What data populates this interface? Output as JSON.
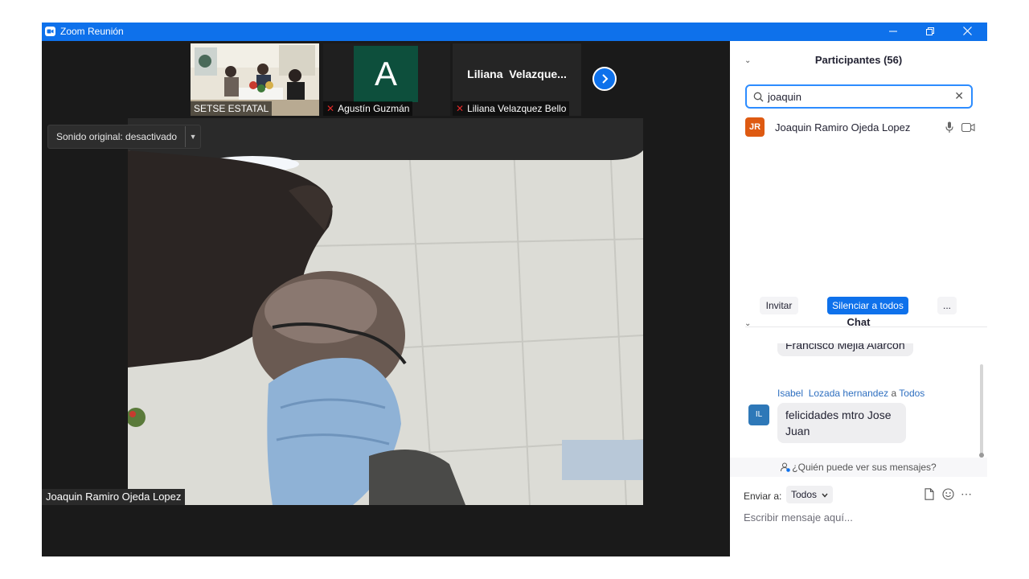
{
  "window": {
    "title": "Zoom Reunión",
    "controls": [
      "minimize",
      "restore",
      "close"
    ]
  },
  "thumbnails": [
    {
      "name": "SETSE ESTATAL",
      "muted": false,
      "type": "video"
    },
    {
      "name": "Agustín Guzmán",
      "muted": true,
      "type": "avatar",
      "initial": "A",
      "color": "#0d4f3c"
    },
    {
      "name": "Liliana Velazquez Bello",
      "muted": true,
      "type": "name-only",
      "display": "Liliana  Velazque..."
    }
  ],
  "stage": {
    "sound_label": "Sonido original: desactivado",
    "speaker_name": "Joaquin Ramiro Ojeda Lopez"
  },
  "participants": {
    "header": "Participantes (56)",
    "search_value": "joaquin",
    "list": [
      {
        "initials": "JR",
        "name": "Joaquin Ramiro Ojeda Lopez",
        "color": "#de5a12"
      }
    ],
    "buttons": {
      "invite": "Invitar",
      "mute_all": "Silenciar a todos",
      "more": "..."
    }
  },
  "chat": {
    "header": "Chat",
    "prev_message_fragment": "Francisco Mejia Alarcón",
    "messages": [
      {
        "sender_first": "Isabel",
        "sender_last": "Lozada hernandez",
        "to_word": "a",
        "recipient": "Todos",
        "initials": "IL",
        "text_line1": "felicidades mtro Jose",
        "text_line2": "Juan"
      }
    ],
    "who_can_see": "¿Quién puede ver sus mensajes?",
    "send_to_label": "Enviar a:",
    "send_to_value": "Todos",
    "input_placeholder": "Escribir mensaje aquí..."
  },
  "colors": {
    "titlebar": "#0e71eb",
    "accent": "#0e71eb",
    "muted_icon": "#e02828"
  }
}
